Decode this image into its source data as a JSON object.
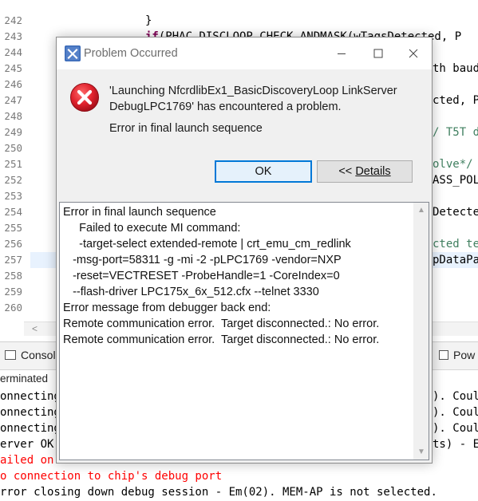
{
  "editor": {
    "line_numbers": [
      "242",
      "243",
      "244",
      "245",
      "246",
      "247",
      "248",
      "249",
      "250",
      "251",
      "252",
      "253",
      "254",
      "255",
      "256",
      "257",
      "258",
      "259",
      "260"
    ],
    "code_lines": [
      {
        "text": "}",
        "indent": 18
      },
      {
        "keyword": "if",
        "text": "(PHAC_DISCLOOP_CHECK_ANDMASK(wTagsDetected, P",
        "indent": 18
      },
      {
        "text": "{",
        "indent": 18
      },
      {
        "text": "th baud",
        "indent": 0
      },
      {
        "text": "",
        "indent": 0
      },
      {
        "text": "cted, P",
        "indent": 0
      },
      {
        "text": "",
        "indent": 0
      },
      {
        "comment": "/ T5T d",
        "indent": 0
      },
      {
        "text": "",
        "indent": 0
      },
      {
        "comment": "olve*/",
        "indent": 0
      },
      {
        "text": "ASS_POL",
        "indent": 0
      },
      {
        "text": "",
        "indent": 0
      },
      {
        "text": "Detecte",
        "indent": 0
      },
      {
        "text": "",
        "indent": 0
      },
      {
        "comment": "cted te",
        "indent": 0
      },
      {
        "text": "pDataPa",
        "indent": 0
      },
      {
        "text": "",
        "indent": 0
      },
      {
        "text": "",
        "indent": 0
      },
      {
        "text": "",
        "indent": 0
      }
    ],
    "scroll_left_glyph": "<"
  },
  "console": {
    "tab_label": "Console",
    "right_tab_label": "Pow",
    "status_text": "erminated",
    "lines": [
      {
        "text": "onnecting",
        "suffix": "). Coul",
        "error": false
      },
      {
        "text": "onnecting",
        "suffix": "). Coul",
        "error": false
      },
      {
        "text": "onnecting",
        "suffix": "). Coul",
        "error": false
      },
      {
        "text": "erver OK",
        "suffix": "ts) - E",
        "error": false
      },
      {
        "text": "ailed on",
        "suffix": "",
        "error": true
      },
      {
        "text": "o connection to chip's debug port",
        "suffix": "",
        "error": true
      },
      {
        "text": "rror closing down debug session - Em(02). MEM-AP is not selected.",
        "suffix": "",
        "error": false
      }
    ]
  },
  "dialog": {
    "title": "Problem Occurred",
    "message": "'Launching NfcrdlibEx1_BasicDiscoveryLoop LinkServer DebugLPC1769' has encountered a problem.",
    "sub_message": "Error in final launch sequence",
    "ok_label": "OK",
    "details_prefix": "<< ",
    "details_label": "Details",
    "details_text": "Error in final launch sequence\n     Failed to execute MI command:\n     -target-select extended-remote | crt_emu_cm_redlink\n   -msg-port=58311 -g -mi -2 -pLPC1769 -vendor=NXP\n   -reset=VECTRESET -ProbeHandle=1 -CoreIndex=0\n   --flash-driver LPC175x_6x_512.cfx --telnet 3330\nError message from debugger back end:\nRemote communication error.  Target disconnected.: No error.\nRemote communication error.  Target disconnected.: No error.",
    "error_color": "#e81123",
    "accent_color": "#0078d7"
  }
}
